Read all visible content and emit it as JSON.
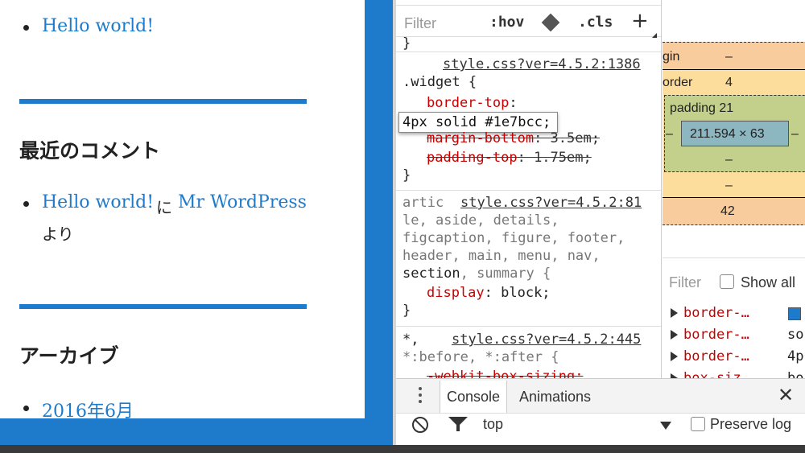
{
  "page": {
    "recent_posts": {
      "item": "Hello world!"
    },
    "recent_comments": {
      "title": "最近のコメント",
      "post_link": "Hello world!",
      "ni": "に",
      "author_link": "Mr WordPress",
      "yori": "より"
    },
    "archives": {
      "title": "アーカイブ",
      "item": "2016年6月"
    },
    "accent_color": "#1e7bcc"
  },
  "devtools": {
    "styles_toolbar": {
      "filter_placeholder": "Filter",
      "hov": ":hov",
      "cls": ".cls",
      "add": "+"
    },
    "rule_top_brace": "}",
    "rule1": {
      "source": "style.css?ver=4.5.2:1386",
      "selector": ".widget {",
      "prop1": "border-top",
      "prop1_colon": ":",
      "edit_value": "4px solid #1e7bcc;",
      "prop2": "margin-bottom",
      "prop2_value": ": 3.5em;",
      "prop3": "padding-top",
      "prop3_value": ": 1.75em;",
      "close": "}"
    },
    "rule2": {
      "selector_line1_prefix": "artic",
      "source": "style.css?ver=4.5.2:81",
      "selector_line2": "le, aside, details,",
      "selector_line3": "figcaption, figure, footer,",
      "selector_line4": "header, main, menu, nav,",
      "selector_line5_a": "section",
      "selector_line5_b": ", summary {",
      "prop": "display",
      "value": ": block;",
      "close": "}"
    },
    "rule3": {
      "selector_line1": "*,",
      "source": "style.css?ver=4.5.2:445",
      "selector_line2": "*:before, *:after {",
      "prop_partial": "-webkit-box-sizing:"
    },
    "box_model": {
      "margin_label": "gin",
      "margin_top": "–",
      "border_label": "order",
      "border_top": "4",
      "padding_label": "padding 21",
      "left_dash": "–",
      "content_size": "211.594 × 63",
      "right_dash": "–",
      "padding_bottom": "–",
      "border_bottom": "–",
      "margin_bottom": "42"
    },
    "computed": {
      "filter_placeholder": "Filter",
      "show_all": "Show all",
      "rows": [
        {
          "name": "border-…",
          "value": ""
        },
        {
          "name": "border-…",
          "value": "so"
        },
        {
          "name": "border-…",
          "value": "4p"
        },
        {
          "name": "box-siz…",
          "value": "bo"
        }
      ],
      "swatch_color": "#1e7bcc"
    },
    "drawer": {
      "tabs": [
        "Console",
        "Animations"
      ],
      "close": "✕",
      "context": "top",
      "preserve_log": "Preserve log"
    }
  }
}
